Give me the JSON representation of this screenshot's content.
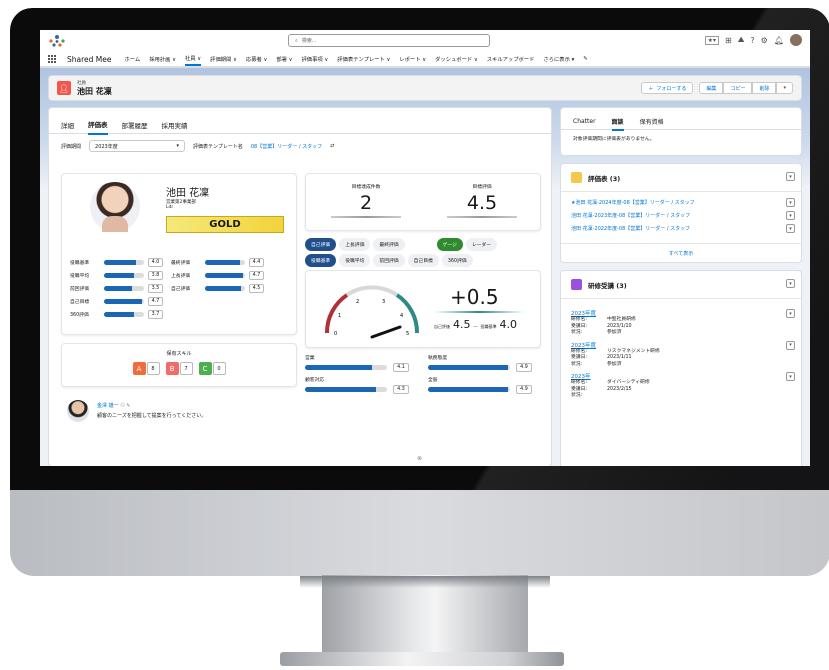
{
  "topbar": {
    "search_placeholder": "検索..."
  },
  "nav": {
    "app_name": "Shared Mee",
    "items": [
      "ホーム",
      "採用計画 ∨",
      "社員 ∨",
      "評価期間 ∨",
      "応募者 ∨",
      "部署 ∨",
      "評価事項 ∨",
      "評価表テンプレート ∨",
      "レポート ∨",
      "ダッシュボード ∨",
      "スキルアップボード",
      "さらに表示 ▾"
    ]
  },
  "record": {
    "object_label": "社員",
    "title": "池田 花凜",
    "follow": "フォローする",
    "edit": "編集",
    "copy": "コピー",
    "delete": "削除"
  },
  "tabs": [
    "詳細",
    "評価表",
    "部署履歴",
    "採用実績"
  ],
  "filters": {
    "period_label": "評価期間",
    "period_value": "2023年度",
    "template_label": "評価表テンプレート名",
    "template_value": "08【営業】リーダー / スタッフ"
  },
  "profile": {
    "name": "池田 花凜",
    "dept": "営業第2事業部",
    "role": "Ldr",
    "rank": "GOLD"
  },
  "metrics": [
    {
      "label": "役職基準",
      "value": "4.0",
      "pct": 0.8,
      "label2": "最終評価",
      "value2": "4.4",
      "pct2": 0.88
    },
    {
      "label": "役職平均",
      "value": "3.8",
      "pct": 0.76,
      "label2": "上長評価",
      "value2": "4.7",
      "pct2": 0.94
    },
    {
      "label": "前回評価",
      "value": "3.5",
      "pct": 0.7,
      "label2": "自己評価",
      "value2": "4.5",
      "pct2": 0.9
    },
    {
      "label": "自己目標",
      "value": "4.7",
      "pct": 0.94
    },
    {
      "label": "360評価",
      "value": "3.7",
      "pct": 0.74
    }
  ],
  "skills": {
    "title": "保有スキル",
    "items": [
      {
        "letter": "A",
        "count": "8",
        "color": "#f26b3a"
      },
      {
        "letter": "B",
        "count": "7",
        "color": "#f26b6b"
      },
      {
        "letter": "C",
        "count": "0",
        "color": "#4caf50"
      }
    ]
  },
  "comment": {
    "name": "金澤 雄一",
    "text": "顧客のニーズを把握して提案を行ってください。"
  },
  "kpi": {
    "count_label": "目標達成件数",
    "count_value": "2",
    "rating_label": "目標評価",
    "rating_value": "4.5"
  },
  "pills1": [
    "自己評価",
    "上長評価",
    "最終評価"
  ],
  "pills1b": [
    "ゲージ",
    "レーダー"
  ],
  "pills2": [
    "役職基準",
    "役職平均",
    "前回評価",
    "自己目標",
    "360評価"
  ],
  "gauge": {
    "delta": "+0.5",
    "self_label": "自己評価",
    "self_value": "4.5",
    "base_label": "役職基準",
    "base_value": "4.0",
    "ticks": [
      "0",
      "1",
      "2",
      "3",
      "4",
      "5"
    ]
  },
  "bars2": [
    {
      "label": "営業",
      "value": "4.1",
      "pct": 0.82
    },
    {
      "label": "執務態度",
      "value": "4.9",
      "pct": 0.98
    },
    {
      "label": "顧客対応",
      "value": "4.3",
      "pct": 0.86
    },
    {
      "label": "全般",
      "value": "4.9",
      "pct": 0.98
    }
  ],
  "right": {
    "tabs": [
      "Chatter",
      "面談",
      "保有資格"
    ],
    "note": "対象評価期間に評価表がありません。",
    "eval_title": "評価表 (3)",
    "eval_links": [
      "★池田 花凜-2024年度-08【営業】リーダー / スタッフ",
      "池田 花凜-2023年度-08【営業】リーダー / スタッフ",
      "池田 花凜-2022年度-08【営業】リーダー / スタッフ"
    ],
    "show_all": "すべて表示",
    "train_title": "研修受講 (3)",
    "trainings": [
      {
        "year": "2023年度",
        "name": "中堅社員研修",
        "date": "2023/1/10",
        "status": "参加済"
      },
      {
        "year": "2023年度",
        "name": "リスクマネジメント研修",
        "date": "2023/1/11",
        "status": "参加済"
      },
      {
        "year": "2023年",
        "name": "ダイバーシティ研修",
        "date": "2023/2/15",
        "status": ""
      }
    ],
    "train_keys": {
      "name": "研修名:",
      "date": "受講日:",
      "status": "状況:"
    }
  }
}
